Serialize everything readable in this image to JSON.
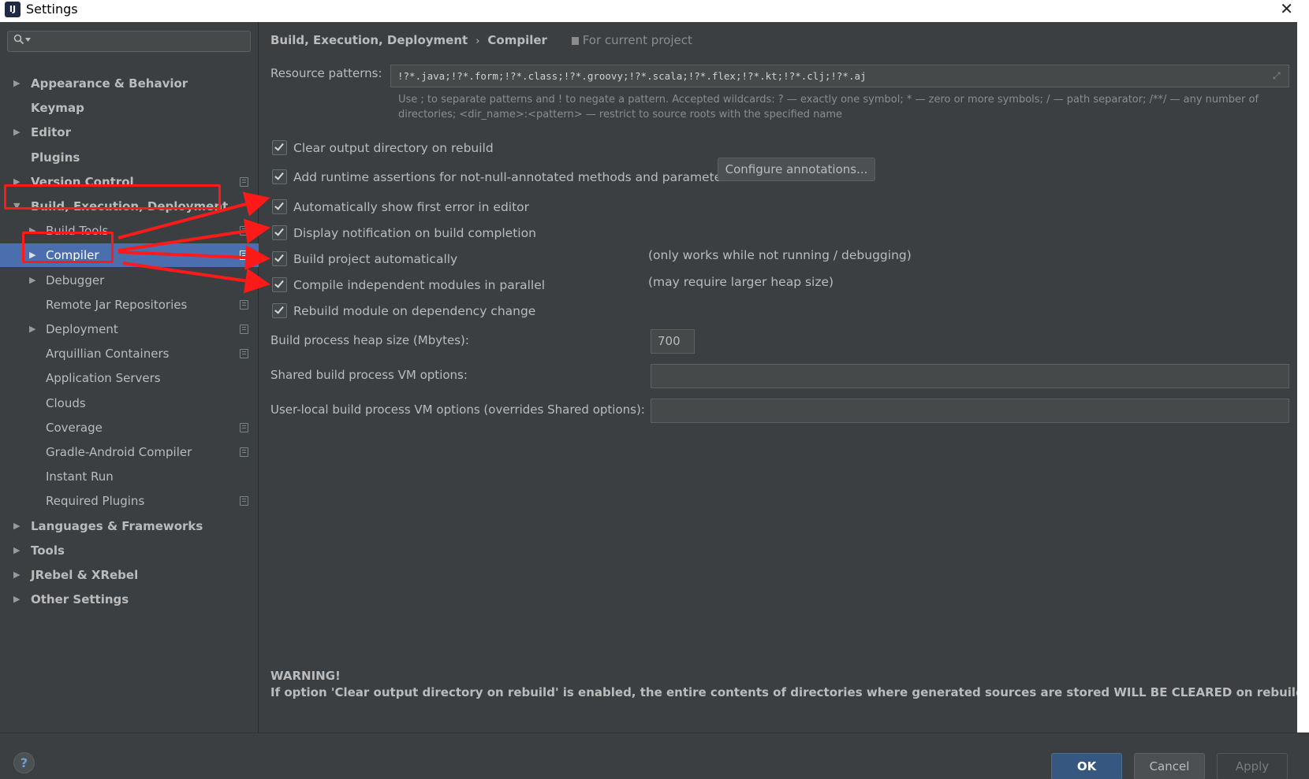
{
  "window": {
    "title": "Settings",
    "icon_text": "IJ",
    "close_glyph": "✕"
  },
  "search": {
    "icon": "search-icon",
    "placeholder": ""
  },
  "sidebar": {
    "items": [
      {
        "label": "Appearance & Behavior",
        "arrow": "▶",
        "bold": true
      },
      {
        "label": "Keymap",
        "arrow": "",
        "bold": true
      },
      {
        "label": "Editor",
        "arrow": "▶",
        "bold": true
      },
      {
        "label": "Plugins",
        "arrow": "",
        "bold": true
      },
      {
        "label": "Version Control",
        "arrow": "▶",
        "bold": true
      },
      {
        "label": "Build, Execution, Deployment",
        "arrow": "▼",
        "bold": true
      },
      {
        "label": "Build Tools",
        "arrow": "▶",
        "bold": false
      },
      {
        "label": "Compiler",
        "arrow": "▶",
        "bold": false,
        "selected": true
      },
      {
        "label": "Debugger",
        "arrow": "▶",
        "bold": false
      },
      {
        "label": "Remote Jar Repositories",
        "arrow": "",
        "bold": false
      },
      {
        "label": "Deployment",
        "arrow": "▶",
        "bold": false
      },
      {
        "label": "Arquillian Containers",
        "arrow": "",
        "bold": false
      },
      {
        "label": "Application Servers",
        "arrow": "",
        "bold": false
      },
      {
        "label": "Clouds",
        "arrow": "",
        "bold": false
      },
      {
        "label": "Coverage",
        "arrow": "",
        "bold": false
      },
      {
        "label": "Gradle-Android Compiler",
        "arrow": "",
        "bold": false
      },
      {
        "label": "Instant Run",
        "arrow": "",
        "bold": false
      },
      {
        "label": "Required Plugins",
        "arrow": "",
        "bold": false
      },
      {
        "label": "Languages & Frameworks",
        "arrow": "▶",
        "bold": true
      },
      {
        "label": "Tools",
        "arrow": "▶",
        "bold": true
      },
      {
        "label": "JRebel & XRebel",
        "arrow": "▶",
        "bold": true
      },
      {
        "label": "Other Settings",
        "arrow": "▶",
        "bold": true
      }
    ]
  },
  "breadcrumb": {
    "parent": "Build, Execution, Deployment",
    "separator": "›",
    "current": "Compiler",
    "project_note": "For current project"
  },
  "resource": {
    "label": "Resource patterns:",
    "value": "!?*.java;!?*.form;!?*.class;!?*.groovy;!?*.scala;!?*.flex;!?*.kt;!?*.clj;!?*.aj",
    "hint_line1": "Use ; to separate patterns and ! to negate a pattern. Accepted wildcards: ? — exactly one symbol; * — zero or more symbols; / — path separator; /**/ — any number of",
    "hint_line2": "directories; <dir_name>:<pattern> — restrict to source roots with the specified name"
  },
  "options": [
    {
      "label": "Clear output directory on rebuild",
      "checked": true
    },
    {
      "label": "Add runtime assertions for not-null-annotated methods and parameters",
      "checked": true
    },
    {
      "label": "Automatically show first error in editor",
      "checked": true
    },
    {
      "label": "Display notification on build completion",
      "checked": true
    },
    {
      "label": "Build project automatically",
      "checked": true
    },
    {
      "label": "Compile independent modules in parallel",
      "checked": true
    },
    {
      "label": "Rebuild module on dependency change",
      "checked": true
    }
  ],
  "configure_button": "Configure annotations...",
  "notes": {
    "build_auto": "(only works while not running / debugging)",
    "parallel": "(may require larger heap size)"
  },
  "heap": {
    "label": "Build process heap size (Mbytes):",
    "value": "700"
  },
  "shared_vm": {
    "label": "Shared build process VM options:",
    "value": ""
  },
  "user_vm": {
    "label": "User-local build process VM options (overrides Shared options):",
    "value": ""
  },
  "warning": {
    "title": "WARNING!",
    "text": "If option 'Clear output directory on rebuild' is enabled, the entire contents of directories where generated sources are stored WILL BE CLEARED on rebuild."
  },
  "footer": {
    "help": "?",
    "ok": "OK",
    "cancel": "Cancel",
    "apply": "Apply"
  },
  "colors": {
    "background": "#3c3f41",
    "selection": "#4b6eaf",
    "annotation": "#ff1a1a",
    "ok_button": "#365880"
  }
}
